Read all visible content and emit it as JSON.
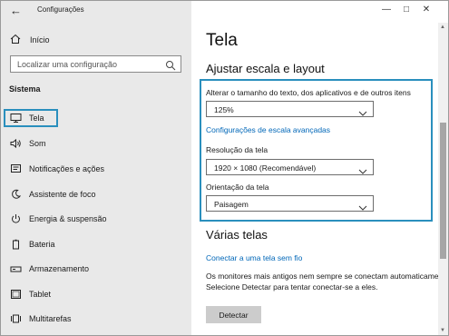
{
  "window": {
    "title": "Configurações"
  },
  "sidebar": {
    "home_label": "Início",
    "search_placeholder": "Localizar uma configuração",
    "section_label": "Sistema",
    "items": [
      {
        "label": "Tela",
        "icon": "monitor-icon"
      },
      {
        "label": "Som",
        "icon": "speaker-icon"
      },
      {
        "label": "Notificações e ações",
        "icon": "notification-icon"
      },
      {
        "label": "Assistente de foco",
        "icon": "moon-icon"
      },
      {
        "label": "Energia & suspensão",
        "icon": "power-icon"
      },
      {
        "label": "Bateria",
        "icon": "battery-icon"
      },
      {
        "label": "Armazenamento",
        "icon": "storage-icon"
      },
      {
        "label": "Tablet",
        "icon": "tablet-icon"
      },
      {
        "label": "Multitarefas",
        "icon": "multitask-icon"
      }
    ]
  },
  "main": {
    "title": "Tela",
    "scale_section": {
      "title": "Ajustar escala e layout",
      "text_size_label": "Alterar o tamanho do texto, dos aplicativos e de outros itens",
      "text_size_value": "125%",
      "advanced_link": "Configurações de escala avançadas",
      "resolution_label": "Resolução da tela",
      "resolution_value": "1920 × 1080 (Recomendável)",
      "orientation_label": "Orientação da tela",
      "orientation_value": "Paisagem"
    },
    "multi_section": {
      "title": "Várias telas",
      "connect_link": "Conectar a uma tela sem fio",
      "description": "Os monitores mais antigos nem sempre se conectam automaticamente. Selecione Detectar para tentar conectar-se a eles.",
      "detect_button": "Detectar"
    }
  },
  "colors": {
    "accent": "#0067b8",
    "highlight": "#2a8fbd",
    "sidebar_bg": "#e9e9e9"
  }
}
